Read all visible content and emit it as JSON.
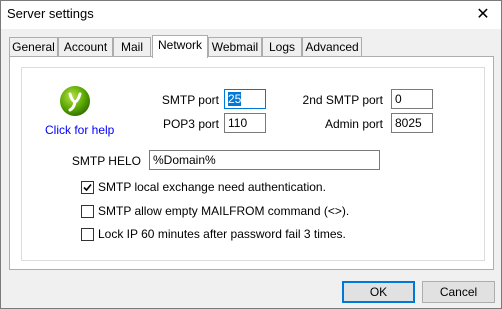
{
  "window": {
    "title": "Server settings",
    "close_glyph": "✕"
  },
  "tabs": [
    {
      "label": "General"
    },
    {
      "label": "Account"
    },
    {
      "label": "Mail"
    },
    {
      "label": "Network",
      "active": true
    },
    {
      "label": "Webmail"
    },
    {
      "label": "Logs"
    },
    {
      "label": "Advanced"
    }
  ],
  "help": {
    "icon": "logo-icon",
    "link_text": "Click for help"
  },
  "fields": {
    "smtp_port": {
      "label": "SMTP port",
      "value": "25"
    },
    "pop3_port": {
      "label": "POP3 port",
      "value": "110"
    },
    "second_smtp_port": {
      "label": "2nd SMTP port",
      "value": "0"
    },
    "admin_port": {
      "label": "Admin port",
      "value": "8025"
    },
    "smtp_helo": {
      "label": "SMTP HELO",
      "value": "%Domain%"
    }
  },
  "checkboxes": [
    {
      "label": "SMTP local exchange need authentication.",
      "checked": true
    },
    {
      "label": "SMTP allow empty MAILFROM command (<>).",
      "checked": false
    },
    {
      "label": "Lock IP 60 minutes after password fail 3 times.",
      "checked": false
    }
  ],
  "buttons": {
    "ok": "OK",
    "cancel": "Cancel"
  },
  "colors": {
    "accent": "#0078d7",
    "link": "#0000ff",
    "logo_green": "#5aa800"
  }
}
